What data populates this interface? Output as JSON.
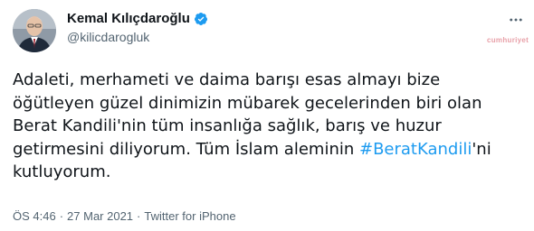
{
  "author": {
    "display_name": "Kemal Kılıçdaroğlu",
    "handle": "@kilicdarogluk",
    "verified": true
  },
  "watermark": "cumhuriyet",
  "tweet": {
    "text_before": "Adaleti, merhameti ve daima barışı esas almayı bize öğütleyen güzel dinimizin mübarek gecelerinden biri olan Berat Kandili'nin tüm insanlığa sağlık, barış ve huzur getirmesini diliyorum. Tüm İslam aleminin ",
    "hashtag": "#BeratKandili",
    "text_after": "'ni kutluyorum."
  },
  "meta": {
    "time": "ÖS 4:46",
    "separator": "·",
    "date": "27 Mar 2021",
    "source": "Twitter for iPhone"
  },
  "colors": {
    "link": "#1d9bf0",
    "secondary": "#536471",
    "verified": "#1d9bf0"
  },
  "icons": {
    "verified": "verified-badge-icon",
    "more": "more-options-icon"
  }
}
